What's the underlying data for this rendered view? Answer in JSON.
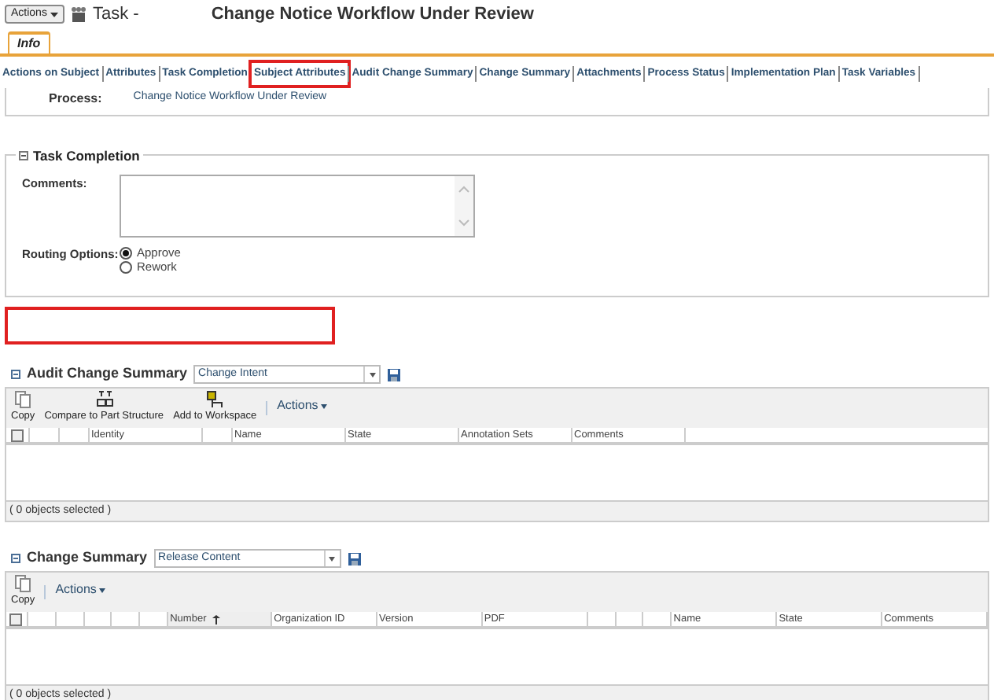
{
  "header": {
    "actions_button": "Actions",
    "task_label": "Task -",
    "title": "Change Notice Workflow Under Review"
  },
  "tabs": [
    {
      "label": "Info",
      "selected": true
    }
  ],
  "nav_links": [
    {
      "label": "Actions on Subject",
      "highlighted": false
    },
    {
      "label": "Attributes",
      "highlighted": false
    },
    {
      "label": "Task Completion",
      "highlighted": false
    },
    {
      "label": "Subject Attributes",
      "highlighted": true
    },
    {
      "label": "Audit Change Summary",
      "highlighted": false
    },
    {
      "label": "Change Summary",
      "highlighted": false
    },
    {
      "label": "Attachments",
      "highlighted": false
    },
    {
      "label": "Process Status",
      "highlighted": false
    },
    {
      "label": "Implementation Plan",
      "highlighted": false
    },
    {
      "label": "Task Variables",
      "highlighted": false
    }
  ],
  "process": {
    "label": "Process:",
    "value": "Change Notice Workflow Under Review"
  },
  "task_completion": {
    "title": "Task Completion",
    "comments_label": "Comments:",
    "routing_label": "Routing Options:",
    "routing_options": [
      {
        "label": "Approve",
        "selected": true
      },
      {
        "label": "Rework",
        "selected": false
      }
    ]
  },
  "highlight_box": {
    "shown": true
  },
  "tables": [
    {
      "title": "Audit Change Summary",
      "view": "Change Intent",
      "select_all_checked": false,
      "toolbar": [
        {
          "kind": "copy",
          "label": "Copy"
        },
        {
          "kind": "compare",
          "label": "Compare to Part Structure"
        },
        {
          "kind": "workspace",
          "label": "Add to Workspace"
        },
        {
          "kind": "menu",
          "label": "Actions"
        }
      ],
      "columns": [
        {
          "kind": "blank"
        },
        {
          "kind": "blank"
        },
        {
          "kind": "text",
          "label": "Identity"
        },
        {
          "kind": "blank"
        },
        {
          "kind": "text",
          "label": "Name"
        },
        {
          "kind": "text",
          "label": "State"
        },
        {
          "kind": "text",
          "label": "Annotation Sets"
        },
        {
          "kind": "text",
          "label": "Comments"
        }
      ],
      "footer": "( 0 objects selected )"
    },
    {
      "title": "Change Summary",
      "view": "Release Content",
      "select_all_checked": false,
      "toolbar": [
        {
          "kind": "copy",
          "label": "Copy"
        },
        {
          "kind": "menu",
          "label": "Actions"
        }
      ],
      "columns": [
        {
          "kind": "blank"
        },
        {
          "kind": "blank"
        },
        {
          "kind": "blank"
        },
        {
          "kind": "blank"
        },
        {
          "kind": "blank"
        },
        {
          "kind": "sorted",
          "label": "Number"
        },
        {
          "kind": "text",
          "label": "Organization ID"
        },
        {
          "kind": "text",
          "label": "Version"
        },
        {
          "kind": "text",
          "label": "PDF"
        },
        {
          "kind": "blank"
        },
        {
          "kind": "blank"
        },
        {
          "kind": "blank"
        },
        {
          "kind": "text",
          "label": "Name"
        },
        {
          "kind": "text",
          "label": "State"
        },
        {
          "kind": "text",
          "label": "Comments"
        }
      ],
      "footer": "( 0 objects selected )"
    }
  ]
}
